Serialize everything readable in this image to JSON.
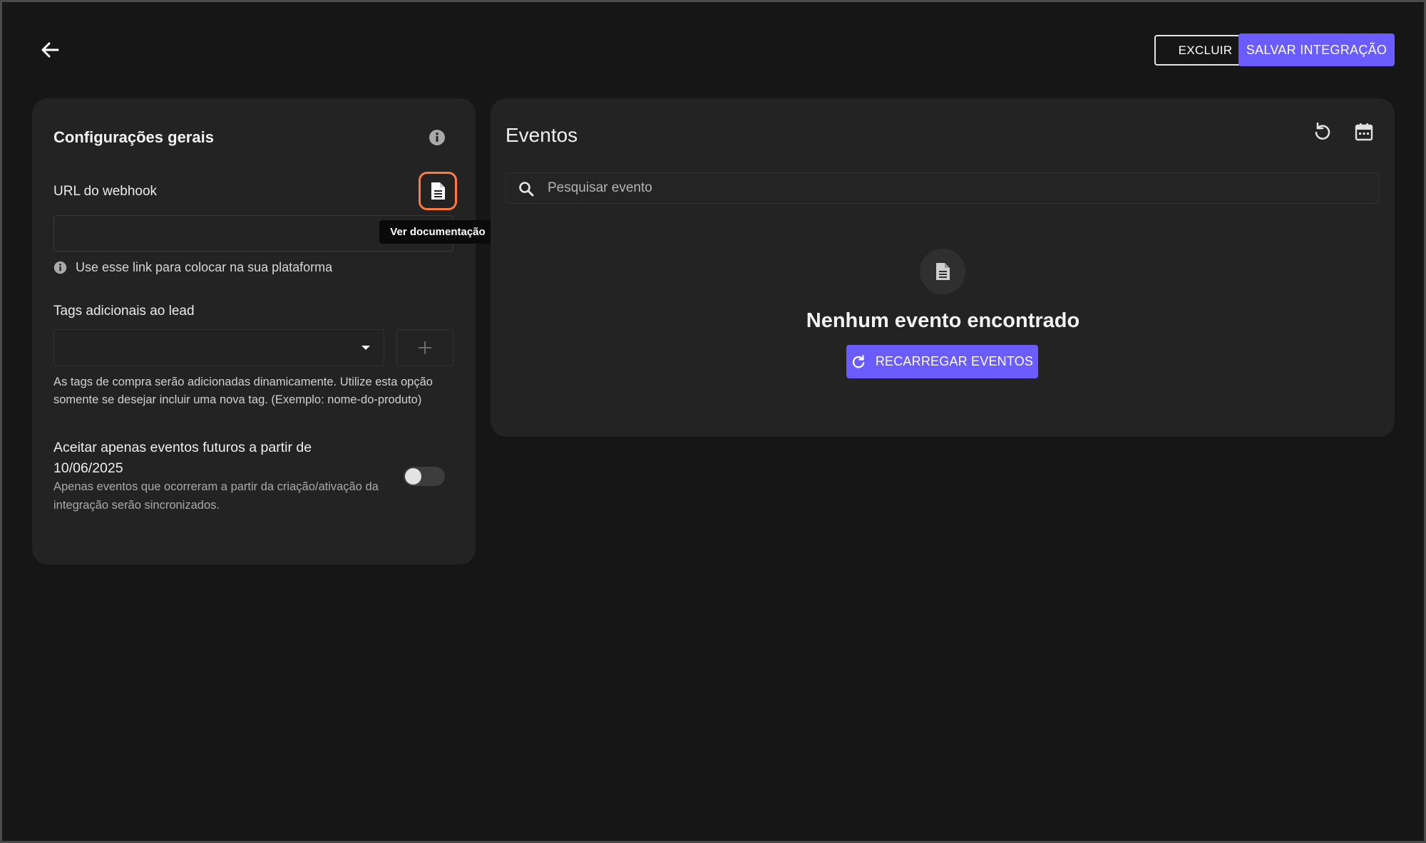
{
  "header": {
    "back_icon": "arrow-left-icon",
    "delete_label": "EXCLUIR",
    "save_label": "SALVAR INTEGRAÇÃO"
  },
  "settings": {
    "title": "Configurações gerais",
    "info_icon": "info-icon",
    "webhook": {
      "label": "URL do webhook",
      "value": "",
      "doc_icon": "document-icon",
      "tooltip": "Ver documentação",
      "hint": "Use esse link para colocar na sua plataforma"
    },
    "tags": {
      "label": "Tags adicionais ao lead",
      "selected": "",
      "add_icon": "plus-icon",
      "help": "As tags de compra serão adicionadas dinamicamente. Utilize esta opção somente se desejar incluir uma nova tag. (Exemplo: nome-do-produto)"
    },
    "future_events": {
      "title": "Aceitar apenas eventos futuros a partir de 10/06/2025",
      "description": "Apenas eventos que ocorreram a partir da criação/ativação da integração serão sincronizados.",
      "enabled": false
    }
  },
  "events": {
    "title": "Eventos",
    "refresh_icon": "refresh-icon",
    "calendar_icon": "calendar-icon",
    "search_placeholder": "Pesquisar evento",
    "empty_icon": "document-icon",
    "empty_title": "Nenhum evento encontrado",
    "reload_label": "RECARREGAR EVENTOS"
  },
  "colors": {
    "background": "#161616",
    "card": "#232323",
    "accent": "#6a5cff",
    "focus_ring": "#ff7a3d"
  }
}
